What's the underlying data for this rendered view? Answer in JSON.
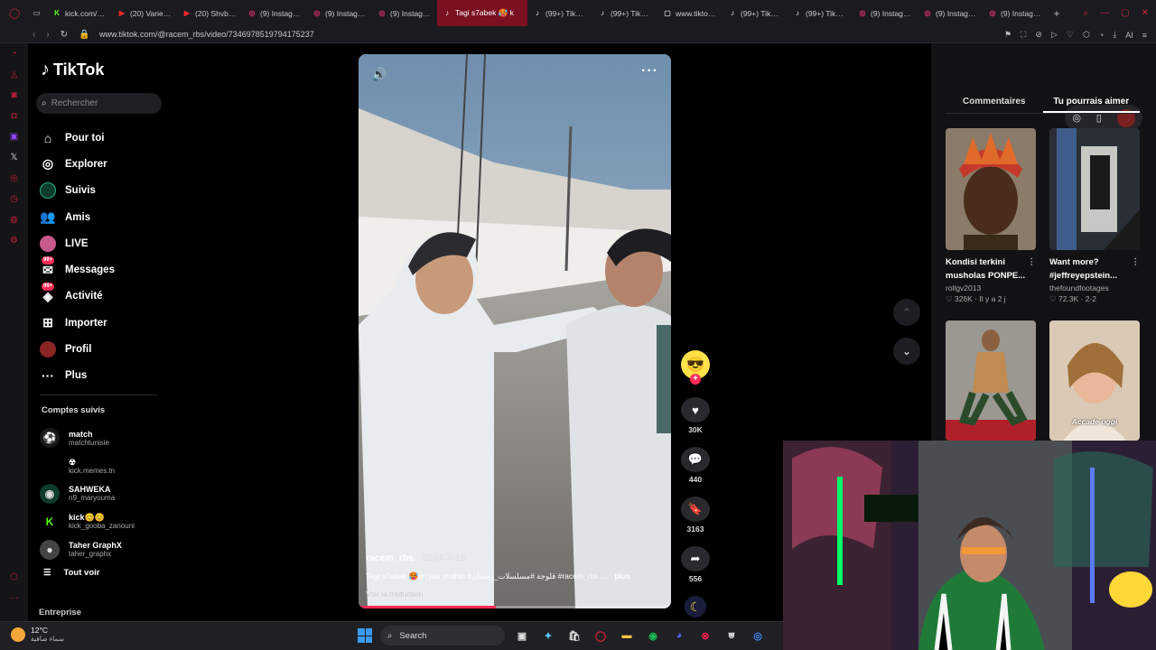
{
  "browser": {
    "tabs": [
      {
        "title": "kick.com/p...",
        "fav": "K",
        "color": "#53fc18"
      },
      {
        "title": "(20) Varien...",
        "fav": "▶",
        "color": "#ff2a2a"
      },
      {
        "title": "(20) Shvbt...",
        "fav": "▶",
        "color": "#ff2a2a"
      },
      {
        "title": "(9) Instagra...",
        "fav": "◎",
        "color": "#e1306c"
      },
      {
        "title": "(9) Instagra...",
        "fav": "◎",
        "color": "#e1306c"
      },
      {
        "title": "(9) Instagra...",
        "fav": "◎",
        "color": "#e1306c"
      },
      {
        "title": "Tagi s7abek 🥵 k",
        "fav": "♪",
        "color": "#ffffff",
        "active": true
      },
      {
        "title": "(99+) TikTo...",
        "fav": "♪",
        "color": "#ffffff"
      },
      {
        "title": "(99+) TikTo...",
        "fav": "♪",
        "color": "#ffffff"
      },
      {
        "title": "www.tiktok...",
        "fav": "▢",
        "color": "#cccccc"
      },
      {
        "title": "(99+) TikTo...",
        "fav": "♪",
        "color": "#ffffff"
      },
      {
        "title": "(99+) TikTo...",
        "fav": "♪",
        "color": "#ffffff"
      },
      {
        "title": "(9) Instagra...",
        "fav": "◎",
        "color": "#e1306c"
      },
      {
        "title": "(9) Instagra...",
        "fav": "◎",
        "color": "#e1306c"
      },
      {
        "title": "(9) Instagra...",
        "fav": "◎",
        "color": "#e1306c"
      }
    ],
    "url": "www.tiktok.com/@racem_rbs/video/7346978519794175237",
    "ai_label": "AI"
  },
  "tiktok": {
    "logo": "TikTok",
    "search_placeholder": "Rechercher",
    "nav": [
      {
        "label": "Pour toi",
        "icon": "home-icon",
        "glyph": "⌂"
      },
      {
        "label": "Explorer",
        "icon": "compass-icon",
        "glyph": "◎"
      },
      {
        "label": "Suivis",
        "icon": "following-icon",
        "glyph": "◉"
      },
      {
        "label": "Amis",
        "icon": "friends-icon",
        "glyph": "👥"
      },
      {
        "label": "LIVE",
        "icon": "live-icon",
        "glyph": "●"
      },
      {
        "label": "Messages",
        "icon": "messages-icon",
        "glyph": "✉",
        "badge": "99+"
      },
      {
        "label": "Activité",
        "icon": "activity-icon",
        "glyph": "◈",
        "badge": "99+"
      },
      {
        "label": "Importer",
        "icon": "upload-icon",
        "glyph": "⊞"
      },
      {
        "label": "Profil",
        "icon": "profile-icon",
        "glyph": "●"
      },
      {
        "label": "Plus",
        "icon": "more-icon",
        "glyph": "···"
      }
    ],
    "followed_title": "Comptes suivis",
    "followed": [
      {
        "name": "match",
        "user": "matchtunisie",
        "color": "#1a1a1a",
        "glyph": "⚽"
      },
      {
        "name": "☢",
        "user": "kick.memes.tn",
        "color": "#000000",
        "glyph": ""
      },
      {
        "name": "SAHWEKA",
        "user": "n9_maryouma",
        "color": "#0d3b2c",
        "glyph": "◉"
      },
      {
        "name": "kick😊😊",
        "user": "kick_gooba_zanouni",
        "color": "#000000",
        "glyph": "K"
      },
      {
        "name": "Taher GraphX",
        "user": "taher_graphx",
        "color": "#444444",
        "glyph": "●"
      }
    ],
    "see_all": "Tout voir",
    "entreprise": "Entreprise"
  },
  "video": {
    "author": "racem_rbs",
    "date": "2024-3-16",
    "caption": "Tagi s7abek 🥵kn jaw ymthlo #قلوجة #مسلسلات_رمضان #racem_rbs ...",
    "more_label": "plus",
    "translation_label": "Voir la traduction",
    "progress": 0.44,
    "likes": "30K",
    "comments": "440",
    "saves": "3163",
    "shares": "556"
  },
  "right_panel": {
    "tabs": [
      "Commentaires",
      "Tu pourrais aimer"
    ],
    "active_tab": 1,
    "recs": [
      {
        "title": "Kondisi terkini musholas PONPE...",
        "author": "rollgv2013",
        "stats": "♡ 326K · Il y a 2 j"
      },
      {
        "title": "Want more? #jeffreyepstein...",
        "author": "thefoundfootages",
        "stats": "♡ 72.3K · 2-2"
      },
      {
        "title": "",
        "author": "",
        "stats": ""
      },
      {
        "title": "",
        "author": "",
        "stats": "",
        "overlay": "Accade oggi"
      }
    ]
  },
  "taskbar": {
    "temperature": "12°C",
    "weather_desc": "سماء صافية",
    "search_label": "Search"
  },
  "colors": {
    "accent": "#fe2c55",
    "opera_red": "#c21d33"
  }
}
